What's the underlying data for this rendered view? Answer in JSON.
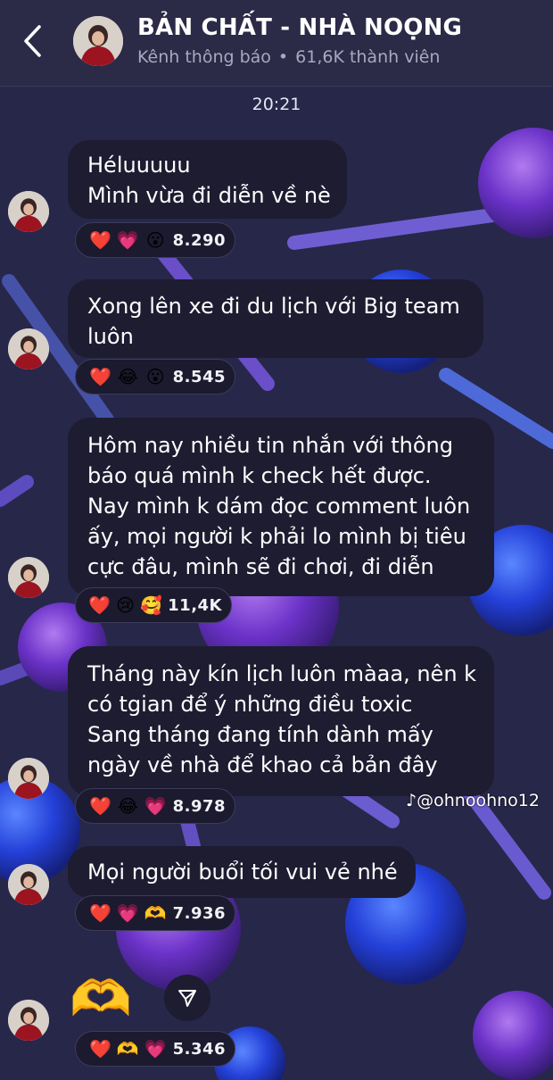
{
  "header": {
    "title": "BẢN CHẤT - NHÀ NOỌNG",
    "subtitle_left": "Kênh thông báo",
    "subtitle_separator": "•",
    "subtitle_right": "61,6K thành viên",
    "back_icon": "chevron-left-icon"
  },
  "timestamp": "20:21",
  "messages": [
    {
      "lines": [
        "Héluuuuu",
        "Mình vừa đi diễn về nè"
      ],
      "reactions": [
        "❤️",
        "💗",
        "😮"
      ],
      "count": "8.290"
    },
    {
      "lines": [
        "Xong lên xe đi du lịch với Big team",
        "luôn"
      ],
      "reactions": [
        "❤️",
        "😂",
        "😮"
      ],
      "count": "8.545"
    },
    {
      "lines": [
        "Hôm nay nhiều tin nhắn với thông",
        "báo quá mình k check hết được.",
        "Nay mình k dám đọc comment luôn",
        "ấy, mọi người k phải lo mình bị tiêu",
        "cực đâu, mình sẽ đi chơi, đi diễn"
      ],
      "reactions": [
        "❤️",
        "😢",
        "🥰"
      ],
      "count": "11,4K"
    },
    {
      "lines": [
        "Tháng này kín lịch luôn màaa, nên k",
        "có tgian để ý những điều toxic",
        "Sang tháng đang tính dành mấy",
        "ngày về nhà để khao cả bản đây"
      ],
      "reactions": [
        "❤️",
        "😂",
        "💗"
      ],
      "count": "8.978"
    },
    {
      "lines": [
        "Mọi người buổi tối vui vẻ nhé"
      ],
      "reactions": [
        "❤️",
        "💗",
        "🫶"
      ],
      "count": "7.936"
    },
    {
      "sticker": "🫶",
      "reactions": [
        "❤️",
        "🫶",
        "💗"
      ],
      "count": "5.346"
    }
  ],
  "watermark": "@ohnoohno12",
  "colors": {
    "background": "#2a2a4e",
    "bubble": "#1d1c31",
    "header": "#2b2a47",
    "lollipop_purple": "#6b3fd6",
    "lollipop_blue": "#2f52e0"
  }
}
